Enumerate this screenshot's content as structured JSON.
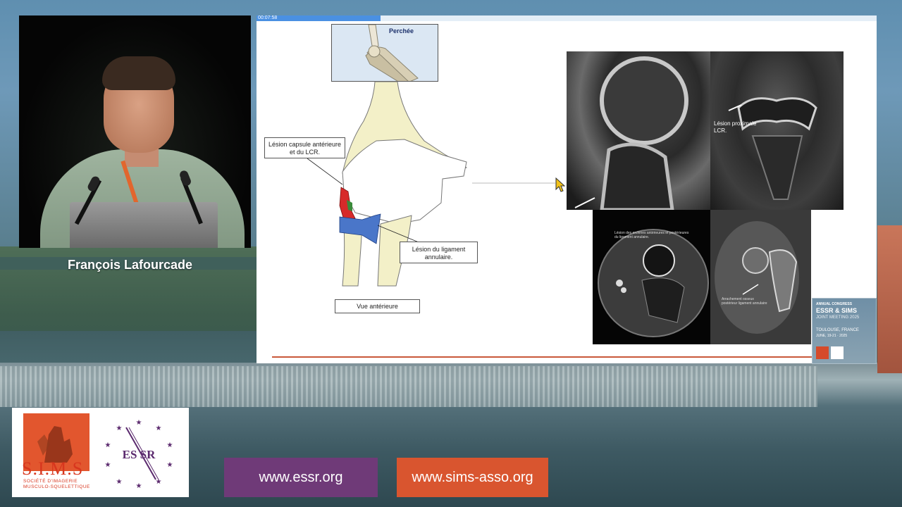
{
  "speaker": {
    "name": "François Lafourcade"
  },
  "slide": {
    "timer": "00:07:58",
    "progress_fraction": 0.2,
    "perchee_label": "Perchée",
    "callout_capsule": [
      "Lésion capsule antérieure",
      "et du LCR."
    ],
    "callout_ligament": [
      "Lésion du ligament",
      "annulaire."
    ],
    "view_label": "Vue antérieure",
    "mri_label_proximal": [
      "Lésion proximale",
      "LCR."
    ],
    "mri_label_axial": [
      "Lésion des erchines antérieures et postérieures",
      "du ligament annulaire."
    ],
    "mri_label_ct": [
      "Arrachement osseux",
      "postérieur ligament annulaire"
    ]
  },
  "badge": {
    "line1": "ANNUAL CONGRESS",
    "line2": "ESSR & SIMS",
    "line3": "JOINT MEETING 2025",
    "line4": "TOULOUSE, FRANCE",
    "line5": "JUNE, 19-21 · 2025"
  },
  "logos": {
    "sims_text": "S.I.M.S",
    "sims_sub": [
      "SOCIÉTÉ D'IMAGERIE",
      "MUSCULO-SQUELETTIQUE"
    ],
    "essr_text": "ES SR"
  },
  "links": {
    "essr": "www.essr.org",
    "sims": "www.sims-asso.org"
  },
  "colors": {
    "essr_purple": "#6f3a78",
    "sims_orange": "#d9552f",
    "progress_blue": "#4a90e2",
    "ligament_blue": "#4a76c9",
    "capsule_red": "#d72a2a"
  }
}
